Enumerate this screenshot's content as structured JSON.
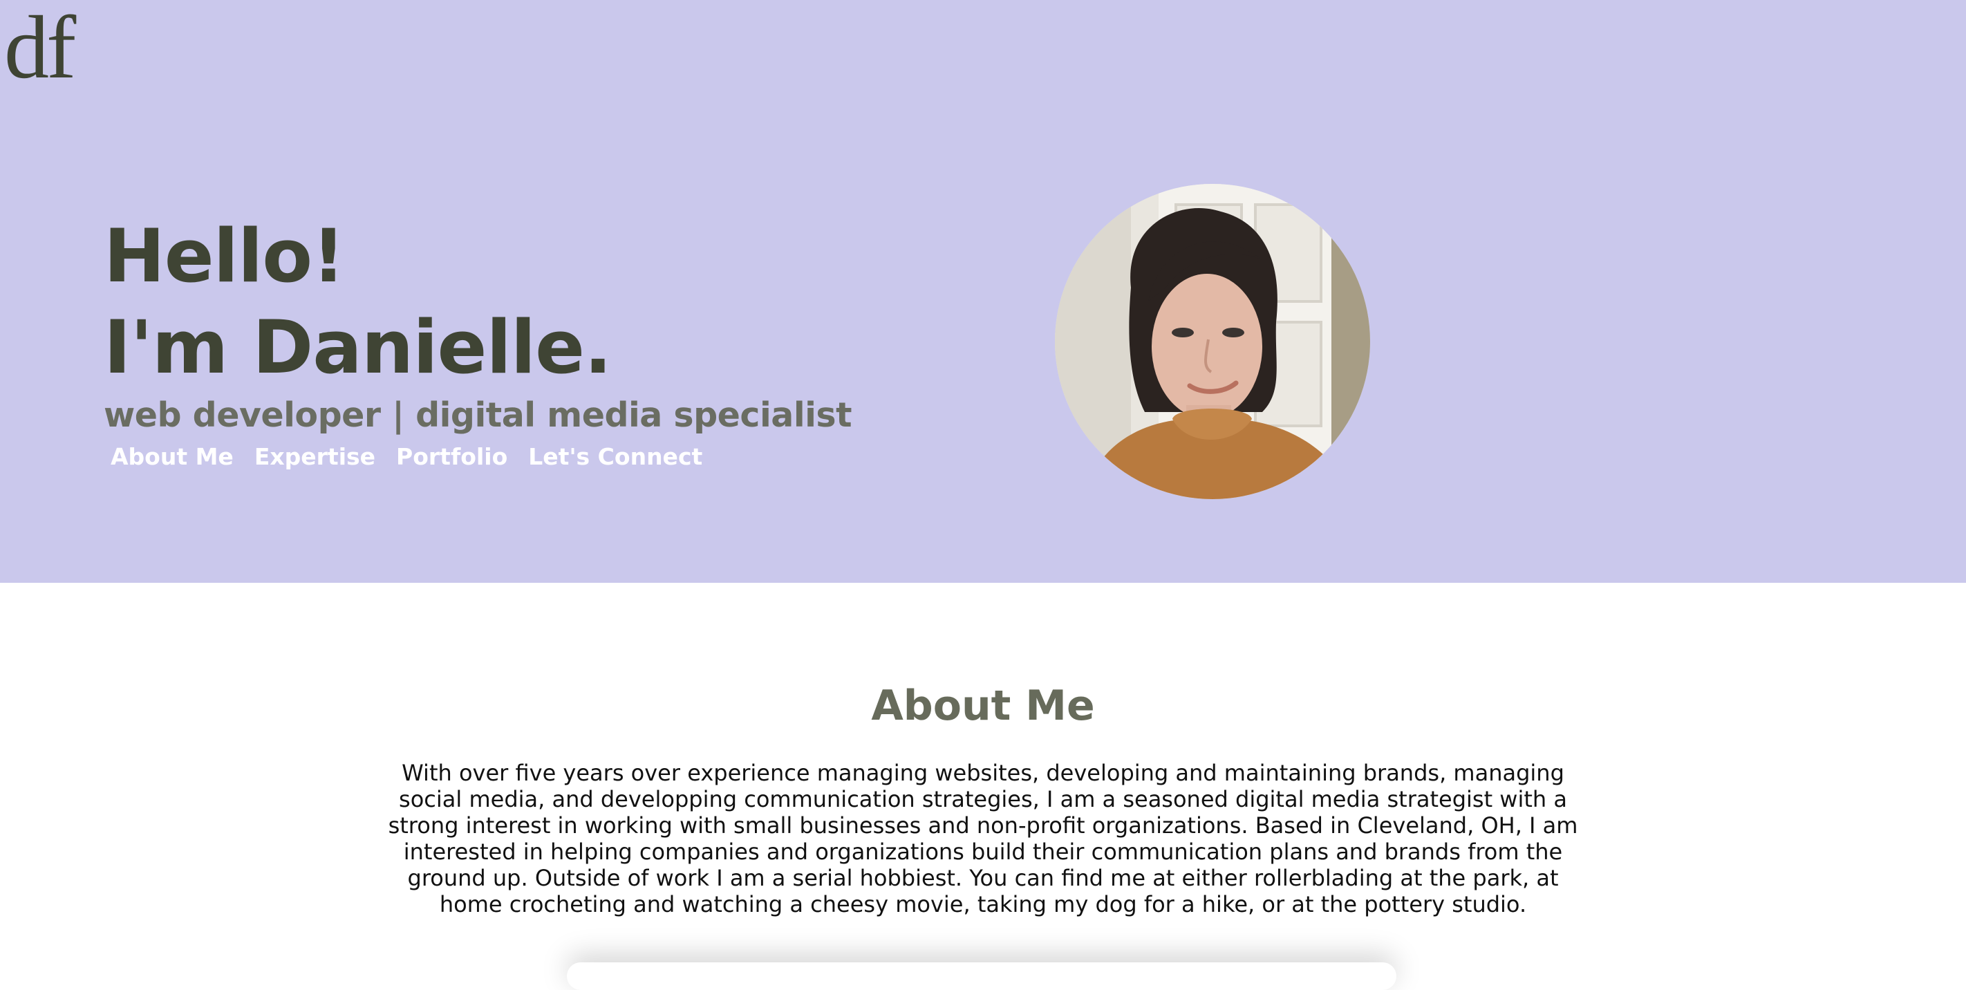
{
  "logo": {
    "text": "df"
  },
  "hero": {
    "greeting_line1": "Hello!",
    "greeting_line2": "I'm Danielle.",
    "tagline": "web developer | digital media specialist",
    "background_color": "#cac8ec",
    "nav": [
      {
        "label": "About Me"
      },
      {
        "label": "Expertise"
      },
      {
        "label": "Portfolio"
      },
      {
        "label": "Let's Connect"
      }
    ]
  },
  "about": {
    "title": "About Me",
    "body": "With over five years over experience managing websites, developing and maintaining brands, managing social media, and developping communication strategies, I am a seasoned digital media strategist with a strong interest in working with small businesses and non-profit organizations. Based in Cleveland, OH, I am interested in helping companies and organizations build their communication plans and brands from the ground up. Outside of work I am a serial hobbiest. You can find me at either rollerblading at the park, at home crocheting and watching a cheesy movie, taking my dog for a hike, or at the pottery studio."
  }
}
